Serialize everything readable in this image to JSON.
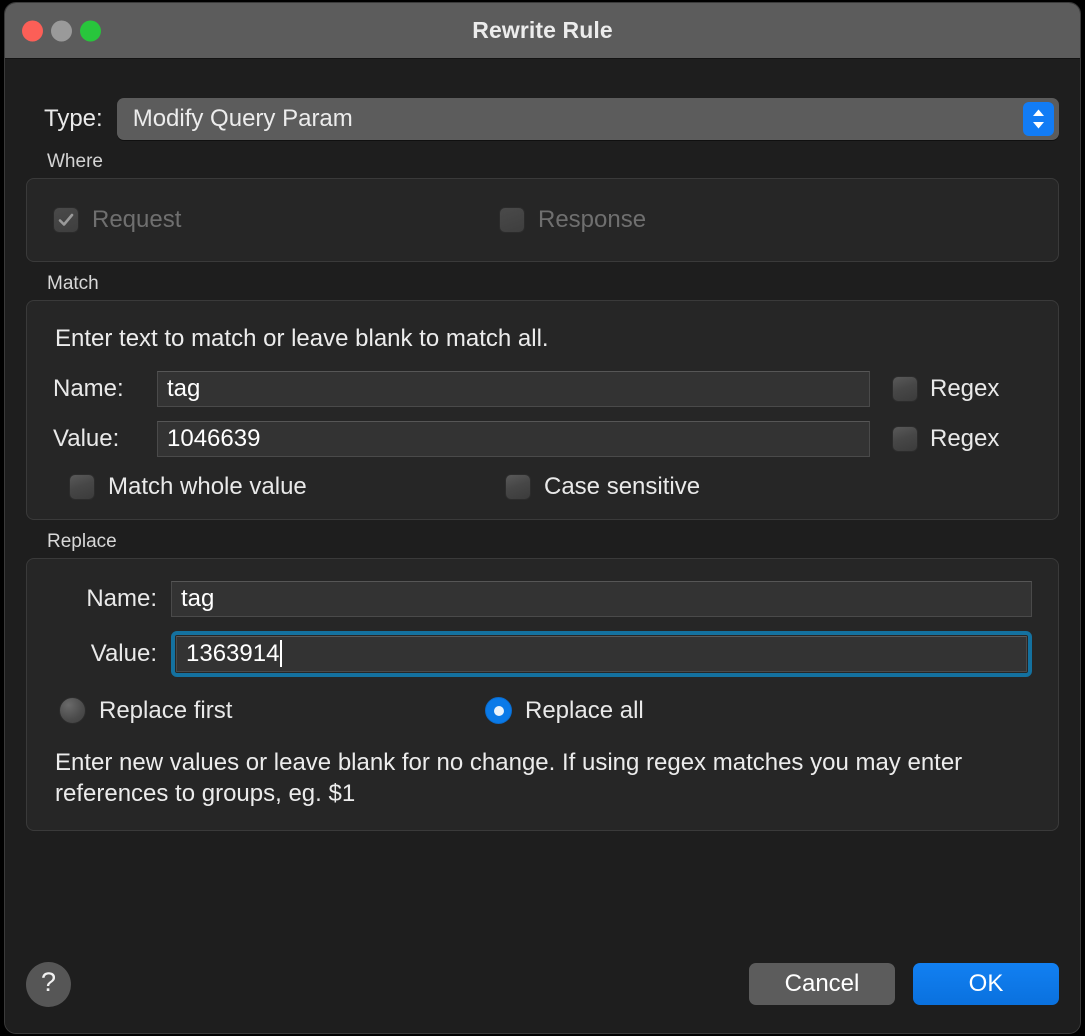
{
  "window": {
    "title": "Rewrite Rule",
    "traffic_lights": [
      {
        "name": "close",
        "color": "#fc5f57"
      },
      {
        "name": "minimize",
        "color": "#9a9a9a"
      },
      {
        "name": "zoom",
        "color": "#28c63c"
      }
    ]
  },
  "type": {
    "label": "Type:",
    "selected": "Modify Query Param",
    "stepper_icon": "up-down-chevrons-icon"
  },
  "where": {
    "group_label": "Where",
    "request": {
      "label": "Request",
      "checked": true,
      "enabled": false
    },
    "response": {
      "label": "Response",
      "checked": false,
      "enabled": false
    }
  },
  "match": {
    "group_label": "Match",
    "hint": "Enter text to match or leave blank to match all.",
    "name_label": "Name:",
    "name_value": "tag",
    "name_regex_label": "Regex",
    "name_regex_checked": false,
    "value_label": "Value:",
    "value_value": "1046639",
    "value_regex_label": "Regex",
    "value_regex_checked": false,
    "whole_value_label": "Match whole value",
    "whole_value_checked": false,
    "case_sensitive_label": "Case sensitive",
    "case_sensitive_checked": false
  },
  "replace": {
    "group_label": "Replace",
    "name_label": "Name:",
    "name_value": "tag",
    "value_label": "Value:",
    "value_value": "1363914",
    "value_focused": true,
    "replace_first_label": "Replace first",
    "replace_first_selected": false,
    "replace_all_label": "Replace all",
    "replace_all_selected": true,
    "hint": "Enter new values or leave blank for no change. If using regex matches you may enter references to groups, eg. $1"
  },
  "footer": {
    "help_label": "?",
    "cancel_label": "Cancel",
    "ok_label": "OK"
  },
  "colors": {
    "accent_blue": "#0a7ae8",
    "focus_ring": "#14719f",
    "window_bg": "#1e1e1e",
    "group_bg": "#262626",
    "titlebar_bg": "#5c5c5c",
    "control_gray": "#5c5c5c"
  }
}
